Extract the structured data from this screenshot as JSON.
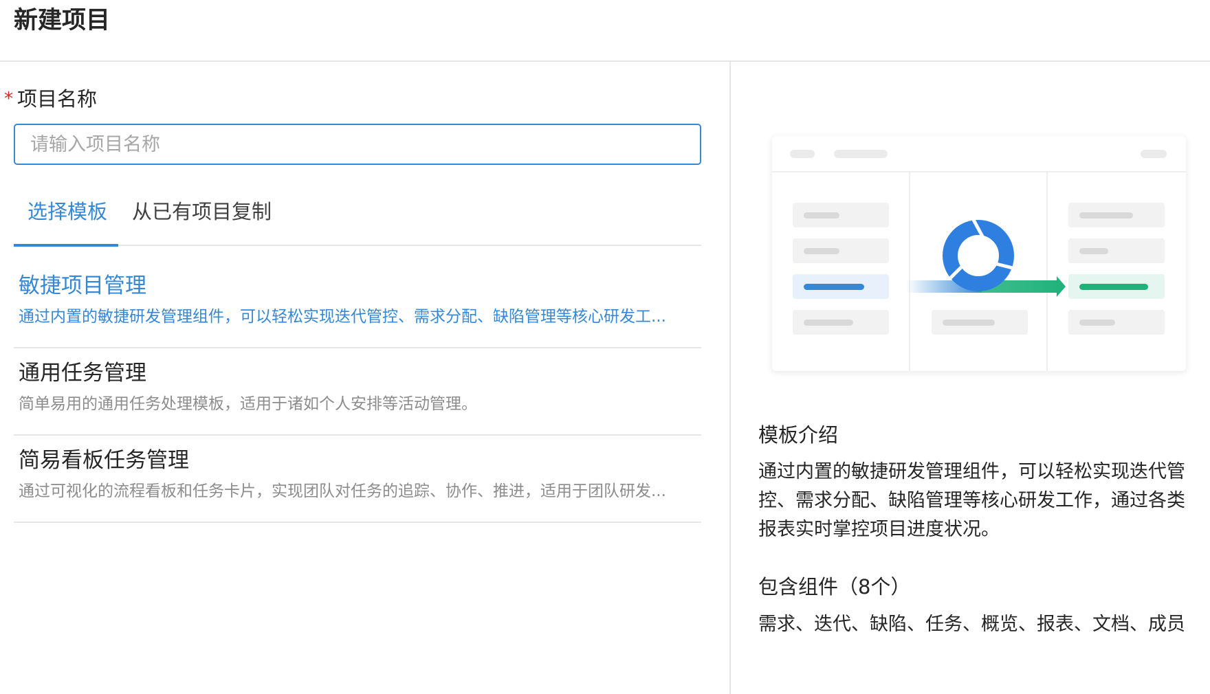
{
  "header": {
    "title": "新建项目"
  },
  "form": {
    "required_mark": "*",
    "name_label": "项目名称",
    "name_placeholder": "请输入项目名称",
    "name_value": ""
  },
  "tabs": [
    {
      "label": "选择模板",
      "active": true
    },
    {
      "label": "从已有项目复制",
      "active": false
    }
  ],
  "templates": [
    {
      "title": "敏捷项目管理",
      "description": "通过内置的敏捷研发管理组件，可以轻松实现迭代管控、需求分配、缺陷管理等核心研发工...",
      "selected": true
    },
    {
      "title": "通用任务管理",
      "description": "简单易用的通用任务处理模板，适用于诸如个人安排等活动管理。",
      "selected": false
    },
    {
      "title": "简易看板任务管理",
      "description": "通过可视化的流程看板和任务卡片，实现团队对任务的追踪、协作、推进，适用于团队研发...",
      "selected": false
    }
  ],
  "detail": {
    "intro_title": "模板介绍",
    "intro_text": "通过内置的敏捷研发管理组件，可以轻松实现迭代管控、需求分配、缺陷管理等核心研发工作，通过各类报表实时掌控项目进度状况。",
    "components_title": "包含组件（8个）",
    "components_text": "需求、迭代、缺陷、任务、概览、报表、文档、成员"
  },
  "preview": {
    "illustration": "agile-flow-illustration",
    "icon": "cycle-arrows-icon"
  },
  "colors": {
    "accent": "#3588d6",
    "success": "#1fb27a",
    "required": "#e02424",
    "muted_text": "#8c8c8c",
    "divider": "#e6e6e6"
  }
}
